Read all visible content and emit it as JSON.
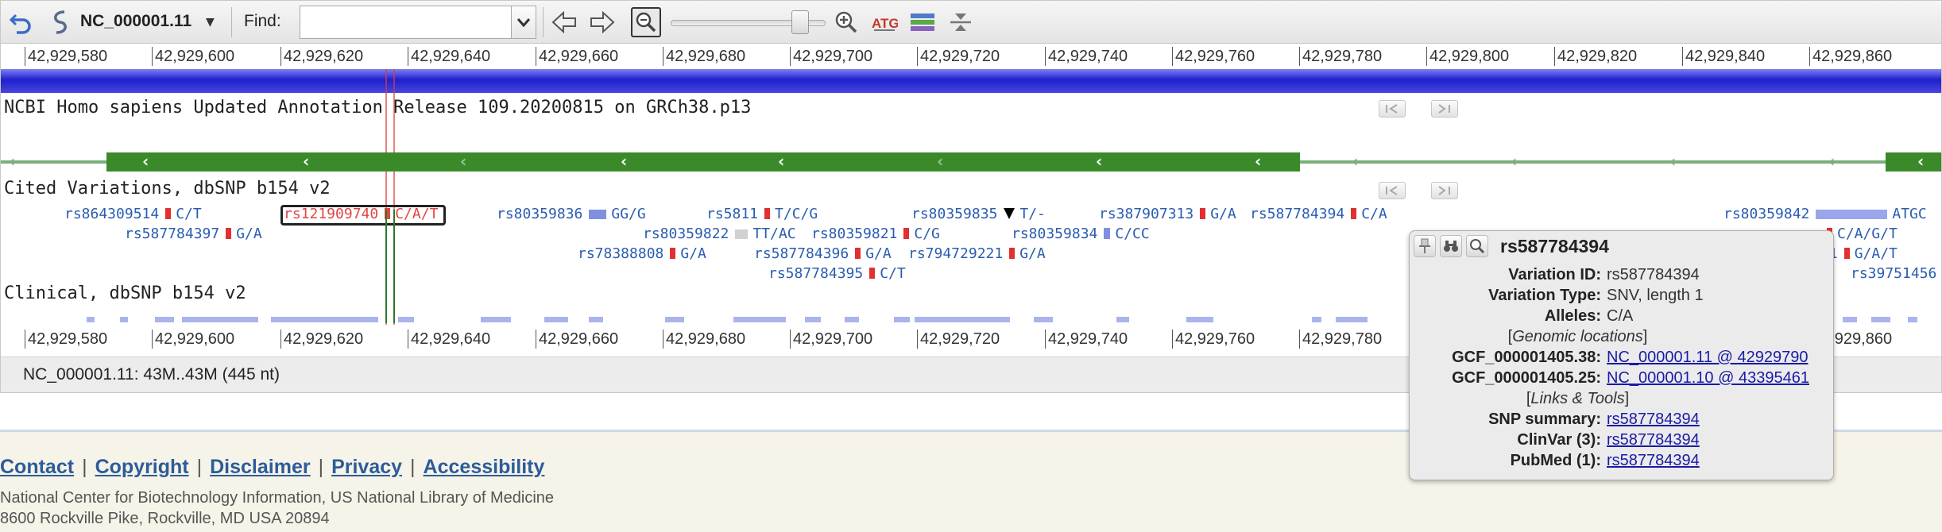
{
  "toolbar": {
    "sequence": "NC_000001.11",
    "find_label": "Find:",
    "find_value": "",
    "colors": {
      "accent": "#2a5db0",
      "seqbar": "#1f1fcf",
      "gene": "#3a8a2a"
    }
  },
  "ruler_top": [
    "42,929,580",
    "42,929,600",
    "42,929,620",
    "42,929,640",
    "42,929,660",
    "42,929,680",
    "42,929,700",
    "42,929,720",
    "42,929,740",
    "42,929,760",
    "42,929,780",
    "42,929,800",
    "42,929,820",
    "42,929,840",
    "42,929,860"
  ],
  "ruler_bottom": [
    "42,929,580",
    "42,929,600",
    "42,929,620",
    "42,929,640",
    "42,929,660",
    "42,929,680",
    "42,929,700",
    "42,929,720",
    "42,929,740",
    "42,929,760",
    "42,929,780",
    "42,929,860"
  ],
  "tracks": {
    "annotation_title": "NCBI Homo sapiens Updated Annotation Release 109.20200815 on GRCh38.p13",
    "cited_title": "Cited Variations, dbSNP b154 v2",
    "clinical_title": "Clinical, dbSNP b154 v2"
  },
  "snps": [
    {
      "id": "rs864309514",
      "allele": "C/T"
    },
    {
      "id": "rs121909740",
      "allele": "C/A/T"
    },
    {
      "id": "rs80359836",
      "allele": "GG/G"
    },
    {
      "id": "rs5811",
      "allele": "T/C/G"
    },
    {
      "id": "rs80359835",
      "allele": "T/-"
    },
    {
      "id": "rs387907313",
      "allele": "G/A"
    },
    {
      "id": "rs587784394",
      "allele": "C/A"
    },
    {
      "id": "rs80359842",
      "allele": "ATGC"
    },
    {
      "id": "rs587784397",
      "allele": "G/A"
    },
    {
      "id": "rs80359822",
      "allele": "TT/AC"
    },
    {
      "id": "rs80359821",
      "allele": "C/G"
    },
    {
      "id": "rs80359834",
      "allele": "C/CC"
    },
    {
      "id": "rs78388808",
      "allele": "G/A"
    },
    {
      "id": "rs587784396",
      "allele": "G/A"
    },
    {
      "id": "rs794729221",
      "allele": "G/A"
    },
    {
      "id": "rs587784395",
      "allele": "C/T"
    },
    {
      "id": "",
      "allele": "C/A/G/T"
    },
    {
      "id": "41",
      "allele": "G/A/T"
    },
    {
      "id": "rs39751456",
      "allele": ""
    }
  ],
  "status": "NC_000001.11: 43M..43M (445 nt)",
  "popup": {
    "title": "rs587784394",
    "variation_id_label": "Variation ID:",
    "variation_id": "rs587784394",
    "variation_type_label": "Variation Type:",
    "variation_type": "SNV, length 1",
    "alleles_label": "Alleles:",
    "alleles": "C/A",
    "genomic_section": "Genomic locations",
    "asm1_label": "GCF_000001405.38:",
    "asm1_value": "NC_000001.11 @ 42929790",
    "asm2_label": "GCF_000001405.25:",
    "asm2_value": "NC_000001.10 @ 43395461",
    "links_section": "Links & Tools",
    "snp_summary_label": "SNP summary:",
    "snp_summary_value": "rs587784394",
    "clinvar_label": "ClinVar (3):",
    "clinvar_value": "rs587784394",
    "pubmed_label": "PubMed (1):",
    "pubmed_value": "rs587784394"
  },
  "footer": {
    "links": [
      "Contact",
      "Copyright",
      "Disclaimer",
      "Privacy",
      "Accessibility"
    ],
    "org": "National Center for Biotechnology Information, US National Library of Medicine",
    "address": "8600 Rockville Pike, Rockville, MD USA 20894"
  }
}
